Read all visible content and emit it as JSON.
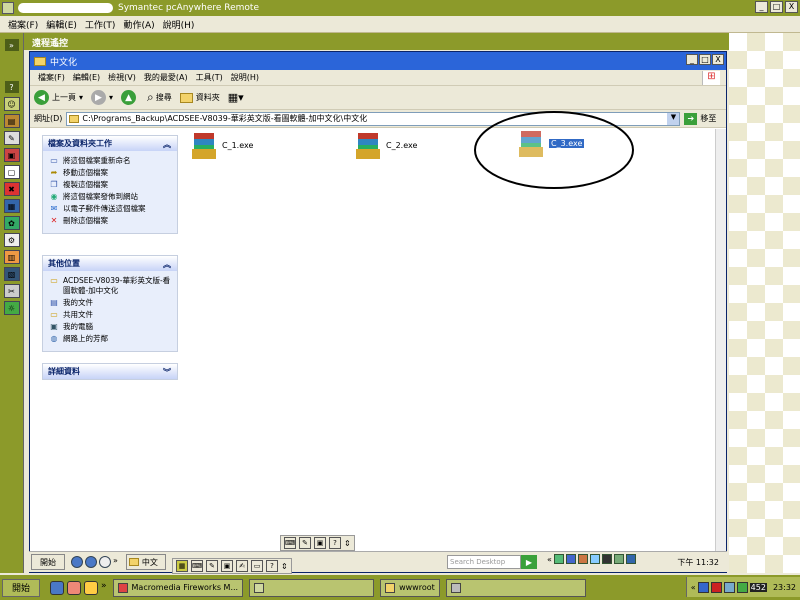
{
  "host": {
    "title": "Symantec pcAnywhere Remote",
    "menu": [
      "檔案(F)",
      "編輯(E)",
      "工作(T)",
      "動作(A)",
      "說明(H)"
    ],
    "remote_header": "遠程遙控",
    "buttons": {
      "minimize": "_",
      "maximize": "□",
      "close": "X"
    }
  },
  "explorer": {
    "title": "中文化",
    "menu": [
      "檔案(F)",
      "編輯(E)",
      "檢視(V)",
      "我的最愛(A)",
      "工具(T)",
      "說明(H)"
    ],
    "toolbar": {
      "back": "上一頁",
      "search": "搜尋",
      "folders": "資料夾"
    },
    "address_label": "網址(D)",
    "address_value": "C:\\Programs_Backup\\ACDSEE-V8039-華彩英文版-看圖軟體-加中文化\\中文化",
    "go_label": "移至",
    "tasks_panel": {
      "title": "檔案及資料夾工作",
      "items": [
        "將這個檔案重新命名",
        "移動這個檔案",
        "複製這個檔案",
        "將這個檔案發佈到網站",
        "以電子郵件傳送這個檔案",
        "刪除這個檔案"
      ]
    },
    "other_panel": {
      "title": "其他位置",
      "items": [
        "ACDSEE-V8039-華彩英文版-看圖軟體-加中文化",
        "我的文件",
        "共用文件",
        "我的電腦",
        "網路上的芳鄰"
      ]
    },
    "details_panel": {
      "title": "詳細資料"
    },
    "files": [
      "C_1.exe",
      "C_2.exe",
      "C_3.exe"
    ]
  },
  "remote_taskbar": {
    "start": "開始",
    "task": "中文",
    "search_placeholder": "Search Desktop",
    "clock": "下午 11:32"
  },
  "local_taskbar": {
    "start": "開始",
    "tasks": [
      "Macromedia Fireworks M...",
      "wwwroot"
    ],
    "clock": "23:32",
    "badge": "452"
  },
  "colors": {
    "host": "#8c9a2a",
    "explorer_title": "#2b65d9",
    "selection": "#316ac5"
  }
}
